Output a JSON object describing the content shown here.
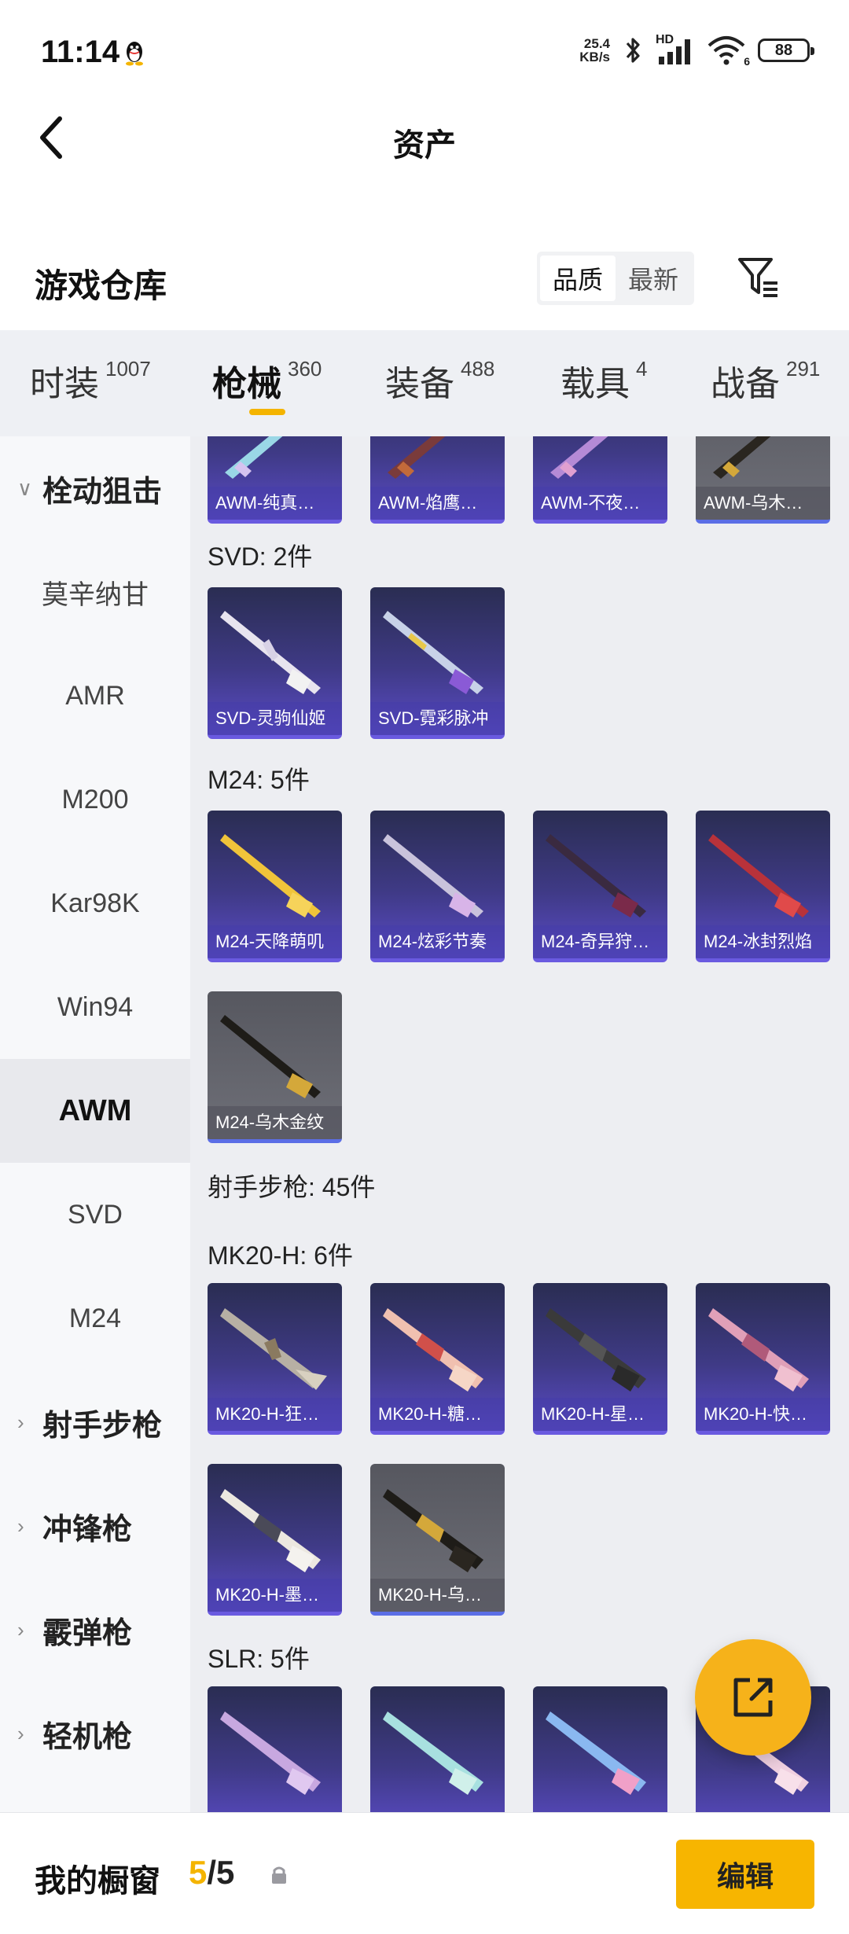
{
  "status_bar": {
    "time": "11:14",
    "net_speed_value": "25.4",
    "net_speed_unit": "KB/s",
    "hd": "HD",
    "wifi_sub": "6",
    "battery": "88"
  },
  "title_bar": {
    "title": "资产"
  },
  "warehouse": {
    "title": "游戏仓库",
    "sort_options": [
      "品质",
      "最新"
    ],
    "active_sort": "品质"
  },
  "tabs": [
    {
      "label": "时装",
      "count": "1007"
    },
    {
      "label": "枪械",
      "count": "360",
      "active": true
    },
    {
      "label": "装备",
      "count": "488"
    },
    {
      "label": "载具",
      "count": "4"
    },
    {
      "label": "战备",
      "count": "291"
    }
  ],
  "sidebar": {
    "items": [
      {
        "label": "栓动狙击",
        "type": "group",
        "expanded": true
      },
      {
        "label": "莫辛纳甘"
      },
      {
        "label": "AMR"
      },
      {
        "label": "M200"
      },
      {
        "label": "Kar98K"
      },
      {
        "label": "Win94"
      },
      {
        "label": "AWM",
        "selected": true
      },
      {
        "label": "SVD"
      },
      {
        "label": "M24"
      },
      {
        "label": "射手步枪",
        "type": "group"
      },
      {
        "label": "冲锋枪",
        "type": "group"
      },
      {
        "label": "霰弹枪",
        "type": "group"
      },
      {
        "label": "轻机枪",
        "type": "group"
      }
    ]
  },
  "content": {
    "awm_row": [
      "AWM-纯真…",
      "AWM-焰鹰…",
      "AWM-不夜…",
      "AWM-乌木…"
    ],
    "svd": {
      "label": "SVD: 2件",
      "items": [
        "SVD-灵驹仙姬",
        "SVD-霓彩脉冲"
      ]
    },
    "m24": {
      "label": "M24: 5件",
      "items": [
        "M24-天降萌叽",
        "M24-炫彩节奏",
        "M24-奇异狩…",
        "M24-冰封烈焰",
        "M24-乌木金纹"
      ]
    },
    "dmr_header": "射手步枪: 45件",
    "mk20": {
      "label": "MK20-H: 6件",
      "items": [
        "MK20-H-狂…",
        "MK20-H-糖…",
        "MK20-H-星…",
        "MK20-H-快…",
        "MK20-H-墨…",
        "MK20-H-乌…"
      ]
    },
    "slr": {
      "label": "SLR: 5件"
    }
  },
  "bottom_bar": {
    "showcase_label": "我的橱窗",
    "showcase_current": "5",
    "showcase_total": "/5",
    "edit_label": "编辑"
  },
  "colors": {
    "accent": "#f4b400",
    "card_purple": "#3f3a86",
    "card_gray": "#65666e"
  }
}
